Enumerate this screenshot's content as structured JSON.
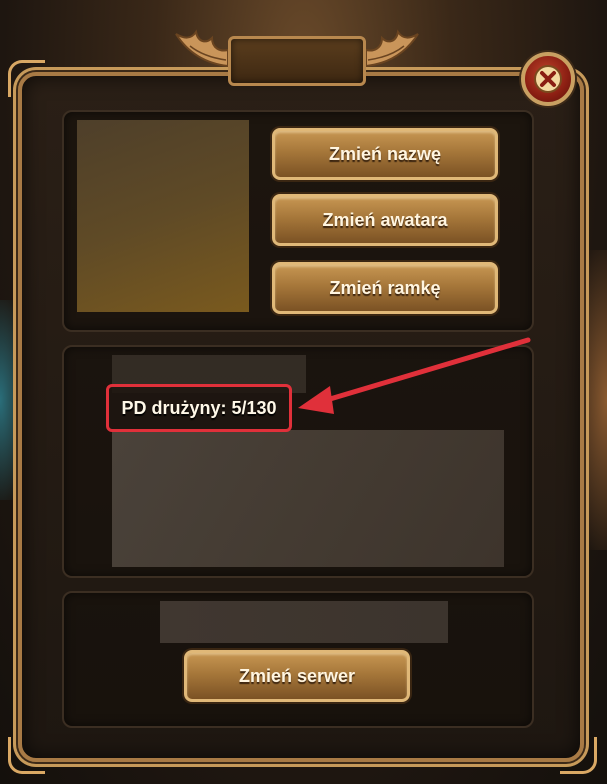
{
  "dialog": {
    "title": ""
  },
  "buttons": {
    "change_name": "Zmień nazwę",
    "change_avatar": "Zmień awatara",
    "change_frame": "Zmień ramkę",
    "change_server": "Zmień serwer"
  },
  "team_info": {
    "pd_label": "PD drużyny: 5/130"
  },
  "colors": {
    "accent_gold": "#c79652",
    "highlight_red": "#e0303a",
    "close_red": "#8a1e12"
  },
  "icons": {
    "close": "close-icon",
    "wings": "wing-ornament-icon"
  }
}
